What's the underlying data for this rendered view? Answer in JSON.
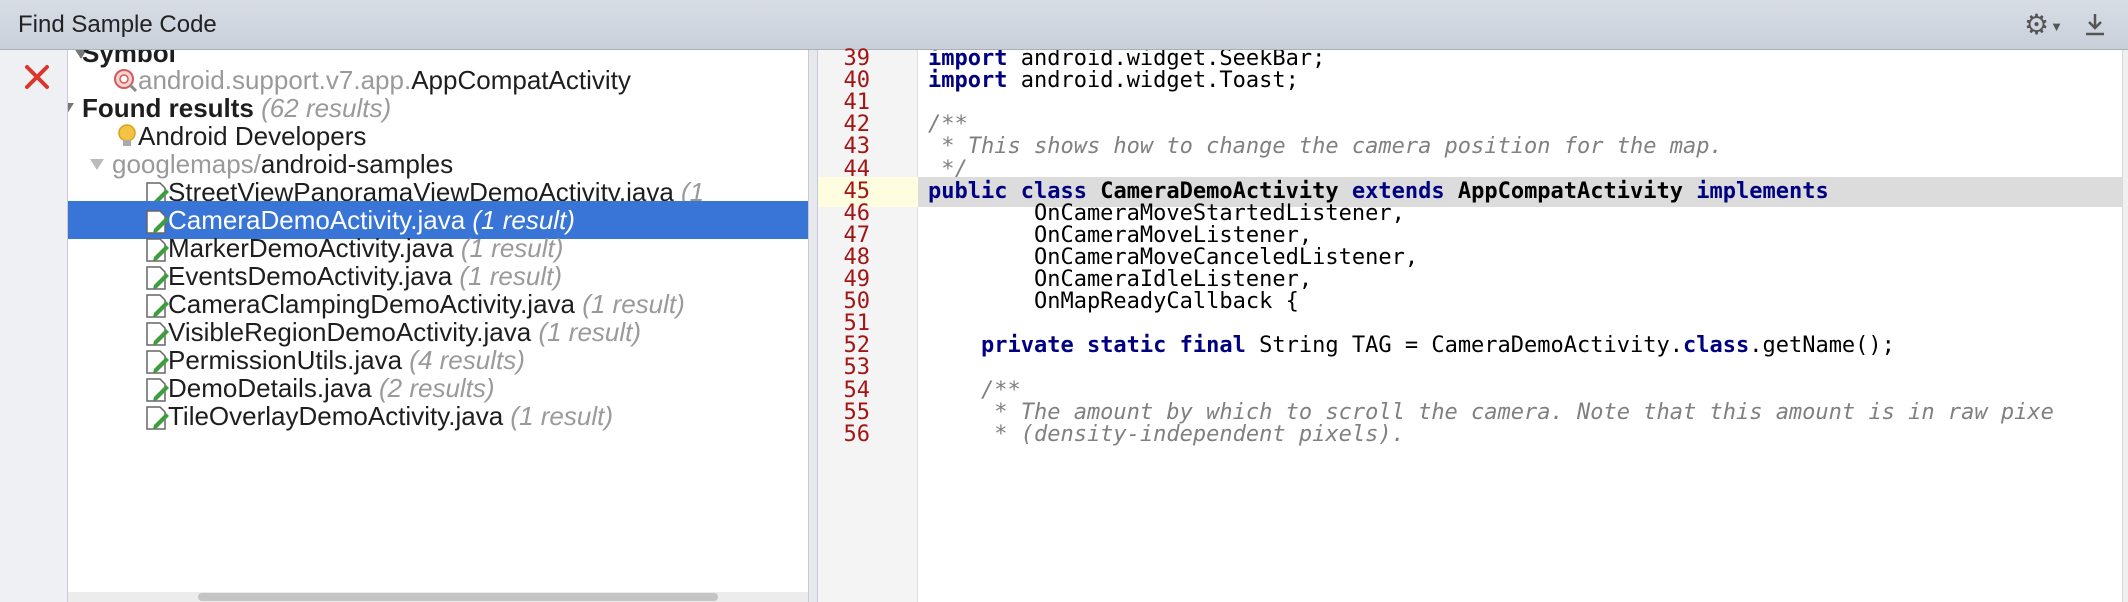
{
  "window": {
    "title": "Find Sample Code"
  },
  "icons": {
    "gear": "gear-icon",
    "pin": "download-pin-icon",
    "close": "close-icon",
    "class": "class-search-icon",
    "bulb": "lightbulb-icon",
    "file": "java-file-icon"
  },
  "tree": {
    "symbol_header": "Symbol",
    "symbol_package": "android.support.v7.app.",
    "symbol_class": "AppCompatActivity",
    "found_header": "Found results",
    "found_count": "(62 results)",
    "source_name": "Android Developers",
    "repo_prefix": "googlemaps/",
    "repo_name": "android-samples",
    "files": [
      {
        "name": "StreetViewPanoramaViewDemoActivity.java",
        "count": "(1"
      },
      {
        "name": "CameraDemoActivity.java",
        "count": "(1 result)",
        "selected": true
      },
      {
        "name": "MarkerDemoActivity.java",
        "count": "(1 result)"
      },
      {
        "name": "EventsDemoActivity.java",
        "count": "(1 result)"
      },
      {
        "name": "CameraClampingDemoActivity.java",
        "count": "(1 result)"
      },
      {
        "name": "VisibleRegionDemoActivity.java",
        "count": "(1 result)"
      },
      {
        "name": "PermissionUtils.java",
        "count": "(4 results)"
      },
      {
        "name": "DemoDetails.java",
        "count": "(2 results)"
      },
      {
        "name": "TileOverlayDemoActivity.java",
        "count": "(1 result)"
      }
    ]
  },
  "code": {
    "highlighted_line": "45",
    "lines": [
      {
        "n": "39",
        "parts": [
          [
            "kw",
            "import"
          ],
          [
            "",
            "android.widget.SeekBar;"
          ]
        ]
      },
      {
        "n": "40",
        "parts": [
          [
            "kw",
            "import"
          ],
          [
            "",
            "android.widget.Toast;"
          ]
        ]
      },
      {
        "n": "41",
        "parts": []
      },
      {
        "n": "42",
        "parts": [
          [
            "cm",
            "/**"
          ]
        ]
      },
      {
        "n": "43",
        "parts": [
          [
            "cm",
            " * This shows how to change the camera position for the map."
          ]
        ]
      },
      {
        "n": "44",
        "parts": [
          [
            "cm",
            " */"
          ]
        ]
      },
      {
        "n": "45",
        "parts": [
          [
            "kw",
            "public class"
          ],
          [
            "cls",
            "CameraDemoActivity"
          ],
          [
            "kw",
            "extends"
          ],
          [
            "cls",
            "AppCompatActivity"
          ],
          [
            "kw",
            "implements"
          ]
        ]
      },
      {
        "n": "46",
        "parts": [
          [
            "",
            "        OnCameraMoveStartedListener,"
          ]
        ]
      },
      {
        "n": "47",
        "parts": [
          [
            "",
            "        OnCameraMoveListener,"
          ]
        ]
      },
      {
        "n": "48",
        "parts": [
          [
            "",
            "        OnCameraMoveCanceledListener,"
          ]
        ]
      },
      {
        "n": "49",
        "parts": [
          [
            "",
            "        OnCameraIdleListener,"
          ]
        ]
      },
      {
        "n": "50",
        "parts": [
          [
            "",
            "        OnMapReadyCallback {"
          ]
        ]
      },
      {
        "n": "51",
        "parts": []
      },
      {
        "n": "52",
        "parts": [
          [
            "",
            "    "
          ],
          [
            "kw",
            "private static final"
          ],
          [
            "",
            "String TAG = CameraDemoActivity."
          ],
          [
            "kw",
            "class"
          ],
          [
            "",
            ".getName();"
          ]
        ]
      },
      {
        "n": "53",
        "parts": []
      },
      {
        "n": "54",
        "parts": [
          [
            "cm",
            "    /**"
          ]
        ]
      },
      {
        "n": "55",
        "parts": [
          [
            "cm",
            "     * The amount by which to scroll the camera. Note that this amount is in raw pixe"
          ]
        ]
      },
      {
        "n": "56",
        "parts": [
          [
            "cm",
            "     * (density-independent pixels)."
          ]
        ]
      }
    ]
  }
}
